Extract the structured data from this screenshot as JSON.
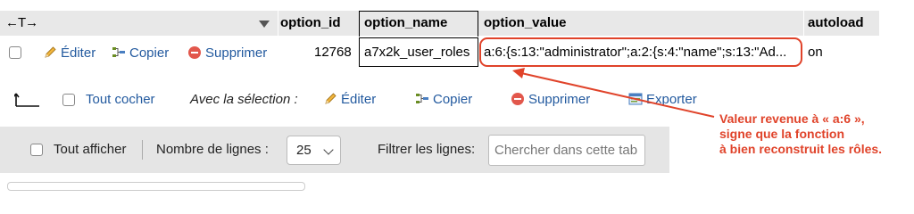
{
  "header": {
    "nav_arrows": "←T→",
    "columns": [
      "option_id",
      "option_name",
      "option_value",
      "autoload"
    ]
  },
  "row": {
    "actions": {
      "edit": "Éditer",
      "copy": "Copier",
      "delete": "Supprimer"
    },
    "option_id": "12768",
    "option_name": "a7x2k_user_roles",
    "option_value": "a:6:{s:13:\"administrator\";a:2:{s:4:\"name\";s:13:\"Ad...",
    "autoload": "on"
  },
  "bulk": {
    "check_all": "Tout cocher",
    "with_selection": "Avec la sélection :",
    "edit": "Éditer",
    "copy": "Copier",
    "delete": "Supprimer",
    "export": "Exporter"
  },
  "annotation": {
    "lines": [
      "Valeur revenue à « a:6 »,",
      "signe que la fonction",
      "à bien reconstruit les rôles."
    ],
    "color": "#e0432a"
  },
  "filter_bar": {
    "show_all": "Tout afficher",
    "rows_label": "Nombre de lignes :",
    "rows_value": "25",
    "filter_label": "Filtrer les lignes:",
    "filter_placeholder": "Chercher dans cette tab"
  },
  "colors": {
    "link": "#235a9f",
    "header_bg": "#e8e8e8",
    "filter_bg": "#e5e5e5",
    "annotation": "#e0432a"
  }
}
